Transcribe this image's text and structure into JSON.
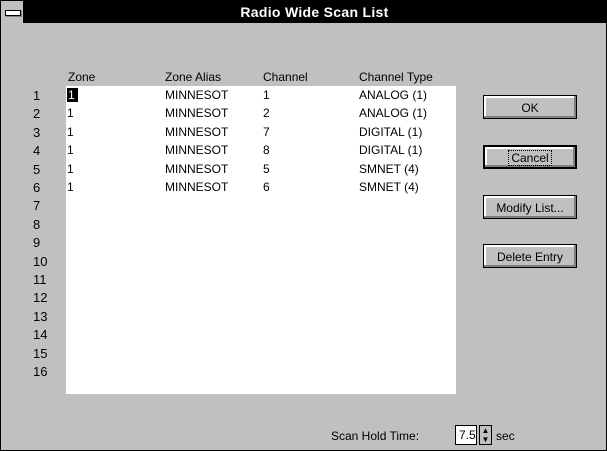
{
  "window": {
    "title": "Radio Wide Scan List"
  },
  "list": {
    "headers": {
      "zone": "Zone",
      "alias": "Zone Alias",
      "channel": "Channel",
      "type": "Channel Type"
    },
    "row_numbers": [
      "1",
      "2",
      "3",
      "4",
      "5",
      "6",
      "7",
      "8",
      "9",
      "10",
      "11",
      "12",
      "13",
      "14",
      "15",
      "16"
    ],
    "entries": [
      {
        "zone": "1",
        "alias": "MINNESOT",
        "channel": "1",
        "type": "ANALOG (1)"
      },
      {
        "zone": "1",
        "alias": "MINNESOT",
        "channel": "2",
        "type": "ANALOG (1)"
      },
      {
        "zone": "1",
        "alias": "MINNESOT",
        "channel": "7",
        "type": "DIGITAL (1)"
      },
      {
        "zone": "1",
        "alias": "MINNESOT",
        "channel": "8",
        "type": "DIGITAL (1)"
      },
      {
        "zone": "1",
        "alias": "MINNESOT",
        "channel": "5",
        "type": "SMNET (4)"
      },
      {
        "zone": "1",
        "alias": "MINNESOT",
        "channel": "6",
        "type": "SMNET (4)"
      }
    ]
  },
  "buttons": {
    "ok": "OK",
    "cancel": "Cancel",
    "modify": "Modify List...",
    "delete": "Delete Entry"
  },
  "scan_hold": {
    "label": "Scan Hold Time:",
    "value": "7.5",
    "unit": "sec"
  }
}
